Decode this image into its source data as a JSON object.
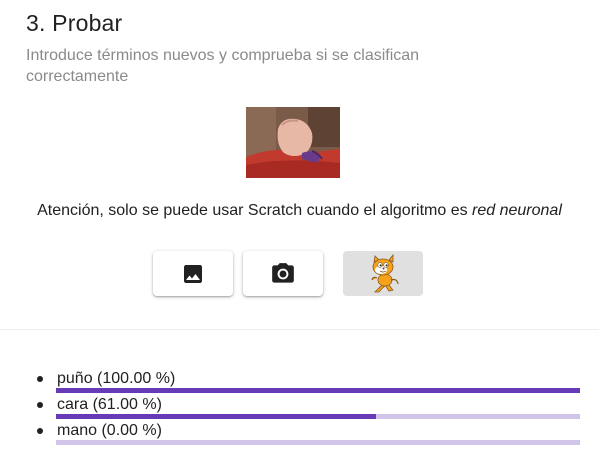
{
  "section": {
    "title": "3. Probar",
    "subtitle": "Introduce términos nuevos y comprueba si se clasifican correctamente"
  },
  "notice": {
    "text": "Atención, solo se puede usar Scratch cuando el algoritmo es ",
    "emphasis": "red neuronal"
  },
  "buttons": {
    "upload_icon": "image-icon",
    "camera_icon": "camera-icon",
    "scratch_icon": "scratch-cat-icon",
    "scratch_disabled": true
  },
  "results": [
    {
      "label": "puño (100.00 %)",
      "confidence": 1.0
    },
    {
      "label": "cara (61.00 %)",
      "confidence": 0.61
    },
    {
      "label": "mano (0.00 %)",
      "confidence": 0.0
    }
  ],
  "colors": {
    "bar_fill": "#673ab7",
    "bar_track": "#d1c4e9",
    "subtitle": "#8a8a8a"
  }
}
